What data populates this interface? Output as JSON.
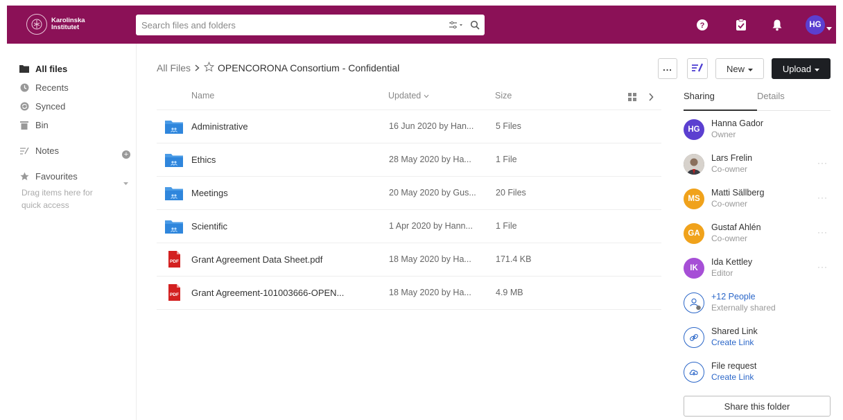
{
  "brand": {
    "name_line1": "Karolinska",
    "name_line2": "Institutet",
    "color": "#8b1157"
  },
  "search": {
    "placeholder": "Search files and folders"
  },
  "topbar": {
    "icons": [
      "help-icon",
      "tasks-icon",
      "bell-icon"
    ],
    "user_initials": "HG"
  },
  "sidebar": {
    "items": [
      {
        "label": "All files",
        "icon": "folder-icon",
        "active": true
      },
      {
        "label": "Recents",
        "icon": "clock-icon"
      },
      {
        "label": "Synced",
        "icon": "sync-icon"
      },
      {
        "label": "Bin",
        "icon": "bin-icon"
      },
      {
        "label": "Notes",
        "icon": "notes-icon"
      },
      {
        "label": "Favourites",
        "icon": "star-icon"
      }
    ],
    "favourites_hint": "Drag items here for quick access"
  },
  "breadcrumb": {
    "root": "All Files",
    "separator": ">",
    "current": "OPENCORONA Consortium - Confidential"
  },
  "toolbar": {
    "more_label": "...",
    "new_label": "New",
    "upload_label": "Upload"
  },
  "table": {
    "columns": {
      "name": "Name",
      "updated": "Updated",
      "size": "Size"
    },
    "rows": [
      {
        "type": "folder",
        "name": "Administrative",
        "updated": "16 Jun 2020 by Han...",
        "size": "5 Files"
      },
      {
        "type": "folder",
        "name": "Ethics",
        "updated": "28 May 2020 by Ha...",
        "size": "1 File"
      },
      {
        "type": "folder",
        "name": "Meetings",
        "updated": "20 May 2020 by Gus...",
        "size": "20 Files"
      },
      {
        "type": "folder",
        "name": "Scientific",
        "updated": "1 Apr 2020 by Hann...",
        "size": "1 File"
      },
      {
        "type": "pdf",
        "name": "Grant Agreement Data Sheet.pdf",
        "updated": "18 May 2020 by Ha...",
        "size": "171.4 KB"
      },
      {
        "type": "pdf",
        "name": "Grant Agreement-101003666-OPEN...",
        "updated": "18 May 2020 by Ha...",
        "size": "4.9 MB"
      }
    ]
  },
  "panel": {
    "tabs": {
      "sharing": "Sharing",
      "details": "Details"
    },
    "people": [
      {
        "initials": "HG",
        "name": "Hanna Gador",
        "role": "Owner",
        "color": "#5b3fd0"
      },
      {
        "initials": "",
        "name": "Lars Frelin",
        "role": "Co-owner",
        "color": "#6e6e6e"
      },
      {
        "initials": "MS",
        "name": "Matti Sällberg",
        "role": "Co-owner",
        "color": "#f0a21b"
      },
      {
        "initials": "GA",
        "name": "Gustaf Ahlén",
        "role": "Co-owner",
        "color": "#f0a21b"
      },
      {
        "initials": "IK",
        "name": "Ida Kettley",
        "role": "Editor",
        "color": "#a64fd6"
      }
    ],
    "external": {
      "label": "+12 People",
      "sub": "Externally shared"
    },
    "shared_link": {
      "label": "Shared Link",
      "action": "Create Link"
    },
    "file_request": {
      "label": "File request",
      "action": "Create Link"
    },
    "share_button": "Share this folder",
    "link_color": "#2a66c8"
  }
}
